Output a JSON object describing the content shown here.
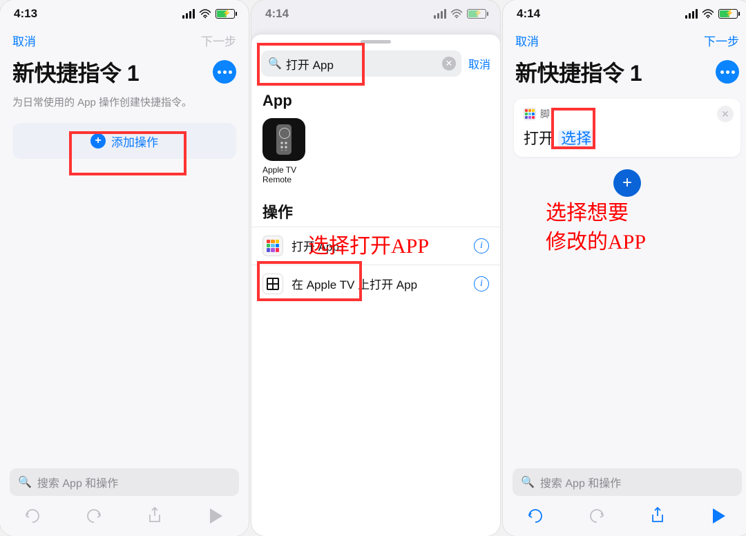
{
  "screen1": {
    "time": "4:13",
    "cancel": "取消",
    "next": "下一步",
    "title": "新快捷指令 1",
    "subtitle": "为日常使用的 App 操作创建快捷指令。",
    "add_action": "添加操作",
    "search_placeholder": "搜索 App 和操作"
  },
  "screen2": {
    "time": "4:14",
    "search_value": "打开 App",
    "cancel": "取消",
    "section_app": "App",
    "app_tile_line1": "Apple TV",
    "app_tile_line2": "Remote",
    "section_actions": "操作",
    "row1": "打开 App",
    "row2": "在 Apple TV 上打开 App",
    "annotation": "选择打开APP"
  },
  "screen3": {
    "time": "4:14",
    "cancel": "取消",
    "next": "下一步",
    "title": "新快捷指令 1",
    "card_header": "脚",
    "card_open": "打开",
    "card_select": "选择",
    "search_placeholder": "搜索 App 和操作",
    "annotation_l1": "选择想要",
    "annotation_l2": "修改的APP"
  },
  "grid_colors": [
    "#ff3b30",
    "#ff9500",
    "#ffcc00",
    "#34c759",
    "#5ac8fa",
    "#007aff",
    "#5856d6",
    "#af52de",
    "#ff2d55"
  ]
}
